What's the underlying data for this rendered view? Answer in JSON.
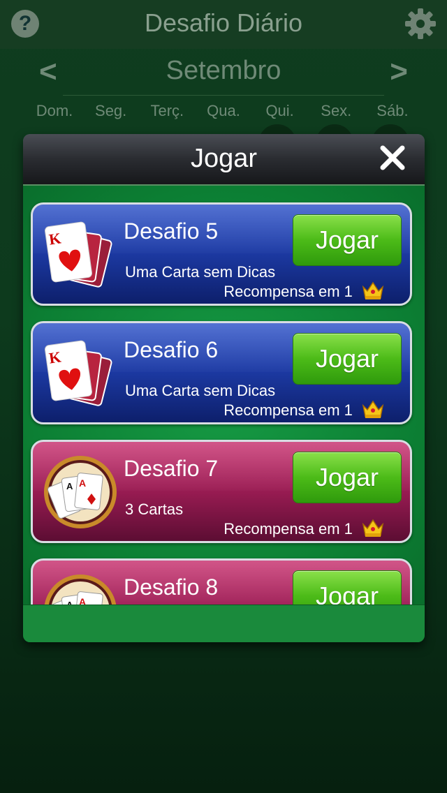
{
  "header": {
    "title": "Desafio Diário",
    "help_label": "?"
  },
  "calendar": {
    "month": "Setembro",
    "prev_arrow": "<",
    "next_arrow": ">",
    "weekdays": [
      "Dom.",
      "Seg.",
      "Terç.",
      "Qua.",
      "Qui.",
      "Sex.",
      "Sáb."
    ]
  },
  "modal": {
    "title": "Jogar",
    "challenges": [
      {
        "title": "Desafio 5",
        "description": "Uma Carta sem Dicas",
        "reward": "Recompensa em 1",
        "button": "Jogar",
        "theme": "blue",
        "art": "king-of-hearts-cards"
      },
      {
        "title": "Desafio 6",
        "description": "Uma Carta sem Dicas",
        "reward": "Recompensa em 1",
        "button": "Jogar",
        "theme": "blue",
        "art": "king-of-hearts-cards"
      },
      {
        "title": "Desafio 7",
        "description": "3 Cartas",
        "reward": "Recompensa em 1",
        "button": "Jogar",
        "theme": "red",
        "art": "three-aces-coin"
      },
      {
        "title": "Desafio 8",
        "description": "",
        "reward": "",
        "button": "Jogar",
        "theme": "red",
        "art": "three-aces-coin"
      }
    ]
  },
  "colors": {
    "blue_card": "#1d3ba6",
    "red_card": "#9e1d55",
    "play_green": "#4cbb18",
    "felt_green": "#0c7e33"
  }
}
